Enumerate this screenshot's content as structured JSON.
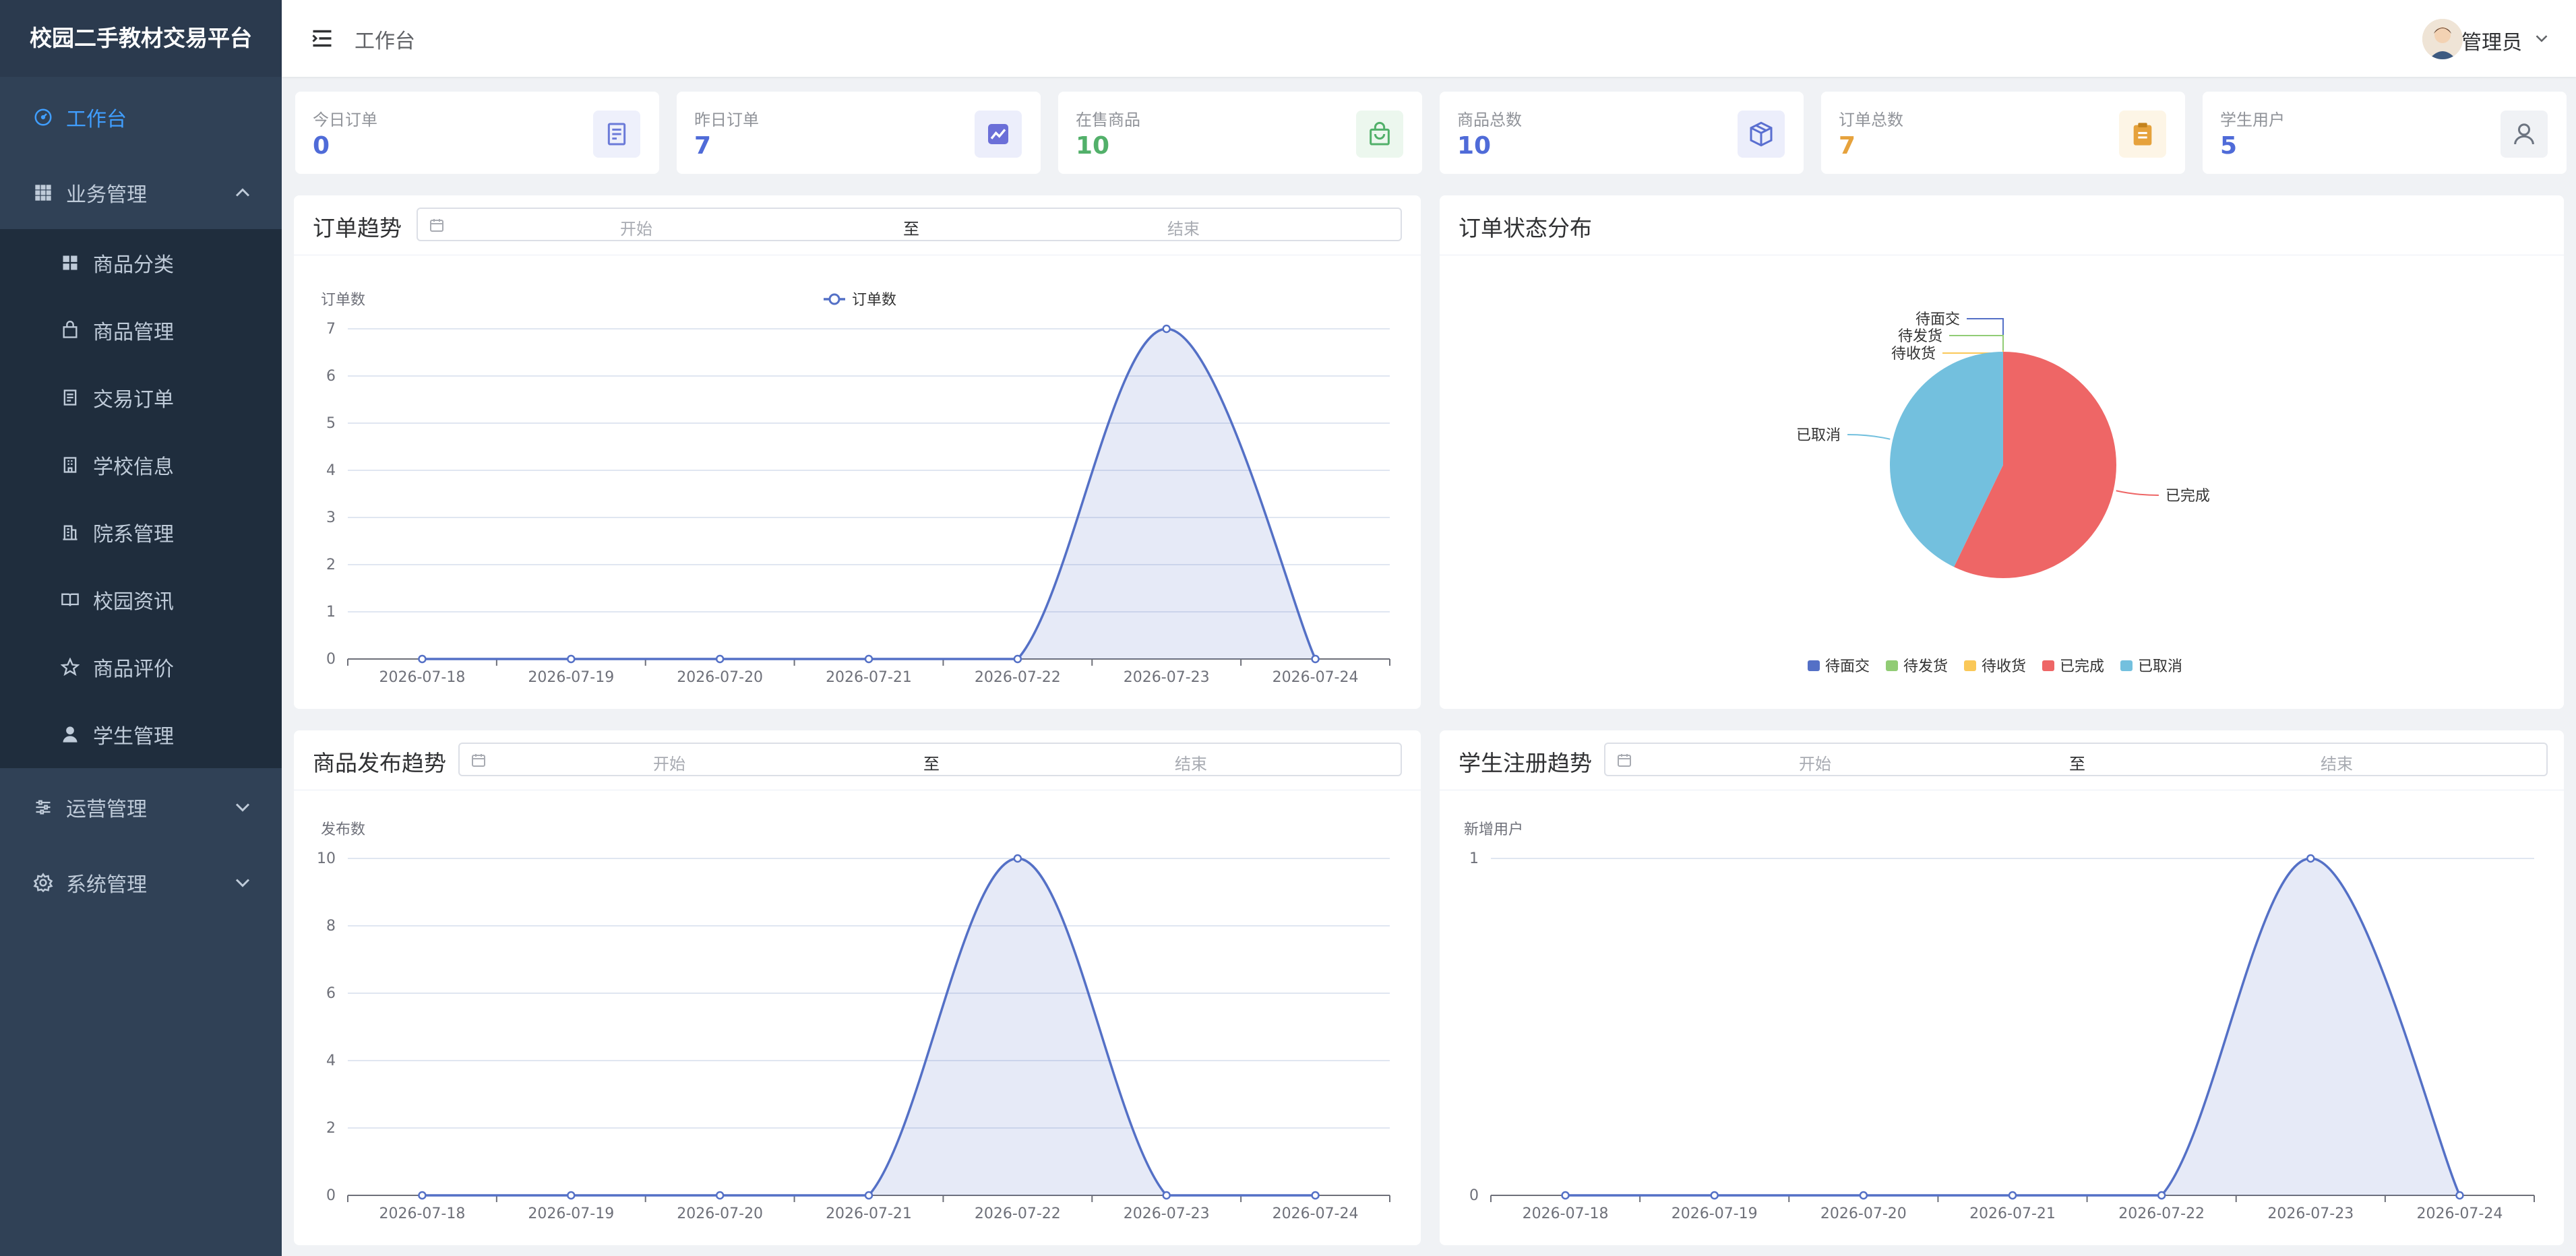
{
  "app": {
    "title": "校园二手教材交易平台"
  },
  "header": {
    "breadcrumb": "工作台",
    "user_name": "管理员"
  },
  "sidebar": {
    "items": [
      {
        "label": "工作台",
        "icon": "dashboard-icon",
        "active": true,
        "level": 1
      },
      {
        "label": "业务管理",
        "icon": "grid-icon",
        "level": 1,
        "expanded": true
      },
      {
        "label": "商品分类",
        "icon": "category-icon",
        "level": 2
      },
      {
        "label": "商品管理",
        "icon": "bag-icon",
        "level": 2
      },
      {
        "label": "交易订单",
        "icon": "document-icon",
        "level": 2
      },
      {
        "label": "学校信息",
        "icon": "school-icon",
        "level": 2
      },
      {
        "label": "院系管理",
        "icon": "building-icon",
        "level": 2
      },
      {
        "label": "校园资讯",
        "icon": "book-icon",
        "level": 2
      },
      {
        "label": "商品评价",
        "icon": "star-icon",
        "level": 2
      },
      {
        "label": "学生管理",
        "icon": "user-icon",
        "level": 2
      },
      {
        "label": "运营管理",
        "icon": "sliders-icon",
        "level": 1,
        "expanded": false
      },
      {
        "label": "系统管理",
        "icon": "gear-icon",
        "level": 1,
        "expanded": false
      }
    ]
  },
  "stats": [
    {
      "label": "今日订单",
      "value": "0",
      "color": "#4f6bd8",
      "icon": "document-icon",
      "icon_bg": "#eef0fb"
    },
    {
      "label": "昨日订单",
      "value": "7",
      "color": "#4f6bd8",
      "icon": "trend-icon",
      "icon_bg": "#eceefb"
    },
    {
      "label": "在售商品",
      "value": "10",
      "color": "#52b06a",
      "icon": "shopping-bag-icon",
      "icon_bg": "#ecf7ee"
    },
    {
      "label": "商品总数",
      "value": "10",
      "color": "#4f6bd8",
      "icon": "box-icon",
      "icon_bg": "#eceefb"
    },
    {
      "label": "订单总数",
      "value": "7",
      "color": "#e6a23c",
      "icon": "clipboard-icon",
      "icon_bg": "#fdf5e6"
    },
    {
      "label": "学生用户",
      "value": "5",
      "color": "#4f6bd8",
      "icon": "person-icon",
      "icon_bg": "#f0f2f5"
    }
  ],
  "range": {
    "start_placeholder": "开始",
    "separator": "至",
    "end_placeholder": "结束"
  },
  "panels": {
    "order_trend": {
      "title": "订单趋势"
    },
    "order_status": {
      "title": "订单状态分布"
    },
    "product_trend": {
      "title": "商品发布趋势"
    },
    "student_trend": {
      "title": "学生注册趋势"
    }
  },
  "chart_data": [
    {
      "id": "order_trend",
      "type": "area",
      "ylabel": "订单数",
      "legend": [
        "订单数"
      ],
      "legend_position": "top",
      "x": [
        "2026-07-18",
        "2026-07-19",
        "2026-07-20",
        "2026-07-21",
        "2026-07-22",
        "2026-07-23",
        "2026-07-24"
      ],
      "series": [
        {
          "name": "订单数",
          "values": [
            0,
            0,
            0,
            0,
            0,
            7,
            0
          ]
        }
      ],
      "ylim": [
        0,
        7
      ],
      "yticks": [
        0,
        1,
        2,
        3,
        4,
        5,
        6,
        7
      ],
      "grid": true,
      "color": "#5470c6"
    },
    {
      "id": "order_status",
      "type": "pie",
      "legend_position": "bottom",
      "slices": [
        {
          "name": "待面交",
          "value": 0,
          "color": "#5470c6"
        },
        {
          "name": "待发货",
          "value": 0,
          "color": "#91cc75"
        },
        {
          "name": "待收货",
          "value": 0,
          "color": "#fac858"
        },
        {
          "name": "已完成",
          "value": 4,
          "color": "#ee6666"
        },
        {
          "name": "已取消",
          "value": 3,
          "color": "#73c0de"
        }
      ]
    },
    {
      "id": "product_trend",
      "type": "area",
      "ylabel": "发布数",
      "x": [
        "2026-07-18",
        "2026-07-19",
        "2026-07-20",
        "2026-07-21",
        "2026-07-22",
        "2026-07-23",
        "2026-07-24"
      ],
      "series": [
        {
          "values": [
            0,
            0,
            0,
            0,
            10,
            0,
            0
          ]
        }
      ],
      "ylim": [
        0,
        10
      ],
      "yticks": [
        0,
        2,
        4,
        6,
        8,
        10
      ],
      "grid": true,
      "color": "#5470c6"
    },
    {
      "id": "student_trend",
      "type": "area",
      "ylabel": "新增用户",
      "x": [
        "2026-07-18",
        "2026-07-19",
        "2026-07-20",
        "2026-07-21",
        "2026-07-22",
        "2026-07-23",
        "2026-07-24"
      ],
      "series": [
        {
          "values": [
            0,
            0,
            0,
            0,
            0,
            1,
            0
          ]
        }
      ],
      "ylim": [
        0,
        1
      ],
      "yticks": [
        0,
        1
      ],
      "grid": true,
      "color": "#5470c6"
    }
  ]
}
